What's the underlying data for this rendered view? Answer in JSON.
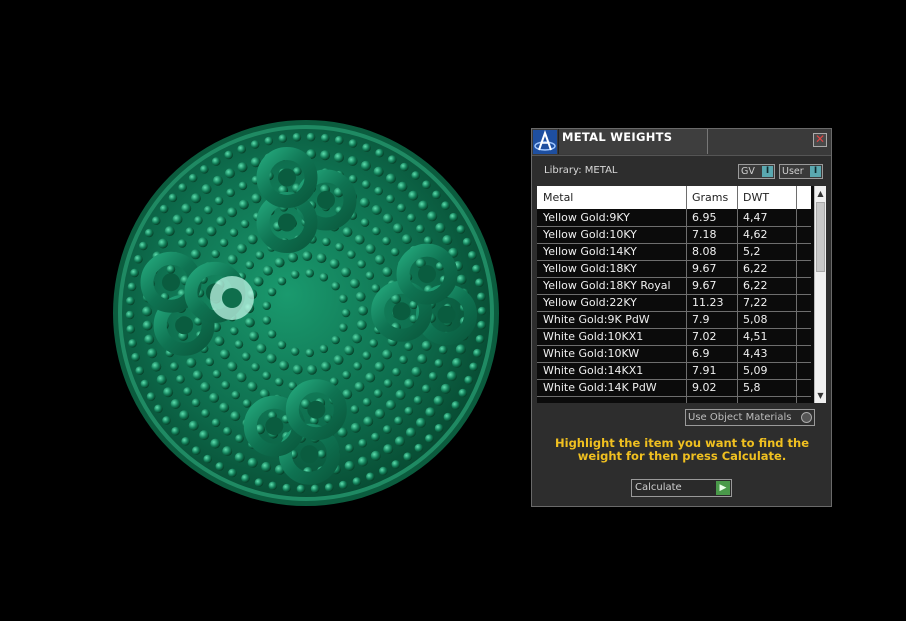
{
  "panel": {
    "title": "METAL WEIGHTS",
    "library_label": "Library: METAL",
    "toggles": [
      {
        "label": "GV",
        "indicator": "I"
      },
      {
        "label": "User",
        "indicator": "I"
      }
    ],
    "columns": [
      "Metal",
      "Grams",
      "DWT"
    ],
    "rows": [
      {
        "metal": "Yellow Gold:9KY",
        "grams": "6.95",
        "dwt": "4,47"
      },
      {
        "metal": "Yellow Gold:10KY",
        "grams": "7.18",
        "dwt": "4,62"
      },
      {
        "metal": "Yellow Gold:14KY",
        "grams": "8.08",
        "dwt": "5,2"
      },
      {
        "metal": "Yellow Gold:18KY",
        "grams": "9.67",
        "dwt": "6,22"
      },
      {
        "metal": "Yellow Gold:18KY Royal",
        "grams": "9.67",
        "dwt": "6,22"
      },
      {
        "metal": "Yellow Gold:22KY",
        "grams": "11.23",
        "dwt": "7,22"
      },
      {
        "metal": "White Gold:9K PdW",
        "grams": "7.9",
        "dwt": "5,08"
      },
      {
        "metal": "White Gold:10KX1",
        "grams": "7.02",
        "dwt": "4,51"
      },
      {
        "metal": "White Gold:10KW",
        "grams": "6.9",
        "dwt": "4,43"
      },
      {
        "metal": "White Gold:14KX1",
        "grams": "7.91",
        "dwt": "5,09"
      },
      {
        "metal": "White Gold:14K PdW",
        "grams": "9.02",
        "dwt": "5,8"
      }
    ],
    "use_object_materials_label": "Use Object Materials",
    "instruction": "Highlight the item you want to find the weight for then press Calculate.",
    "calculate_label": "Calculate",
    "colors": {
      "accent_text": "#f0c020",
      "panel_bg": "#2d2d2d",
      "toggle_indicator": "#5aa8b0",
      "calc_play": "#4a9a4a",
      "model_green": "#0f7a55"
    },
    "icons": {
      "app_logo": "a-logo-icon",
      "close": "close-icon",
      "scroll_up": "chevron-up-icon",
      "scroll_down": "chevron-down-icon",
      "play": "play-icon"
    }
  }
}
